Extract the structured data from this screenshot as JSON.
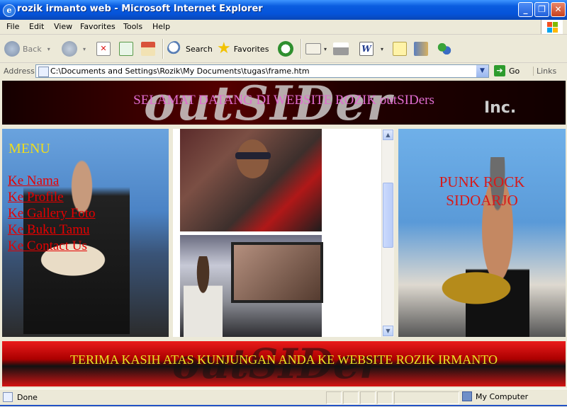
{
  "window": {
    "title": "rozik irmanto web - Microsoft Internet Explorer"
  },
  "menu": [
    "File",
    "Edit",
    "View",
    "Favorites",
    "Tools",
    "Help"
  ],
  "toolbar": {
    "back": "Back",
    "search": "Search",
    "favorites": "Favorites"
  },
  "address": {
    "label": "Address",
    "url": "C:\\Documents and Settings\\Rozik\\My Documents\\tugas\\frame.htm",
    "go": "Go",
    "links": "Links"
  },
  "page": {
    "banner_text": "SELAMAT DATANG DI WEBSITE ROZIK outSIDers",
    "banner_logo": "outSIDer",
    "banner_inc": "Inc.",
    "menu_title": "MENU",
    "nav_links": [
      "Ke Nama",
      "Ke Profile",
      "Ke Gallery Foto",
      "Ke Buku Tamu",
      "Ke Contact Us"
    ],
    "right_text_1": "PUNK ROCK",
    "right_text_2": "SIDOARJO",
    "footer_text": "TERIMA KASIH ATAS KUNJUNGAN ANDA KE WEBSITE ROZIK IRMANTO"
  },
  "status": {
    "text": "Done",
    "zone": "My Computer"
  },
  "colors": {
    "titlebar": "#0553d9",
    "link": "#e50000",
    "menu_title": "#eddc1e",
    "banner_text": "#e06cd0",
    "footer_text": "#e7e626"
  }
}
